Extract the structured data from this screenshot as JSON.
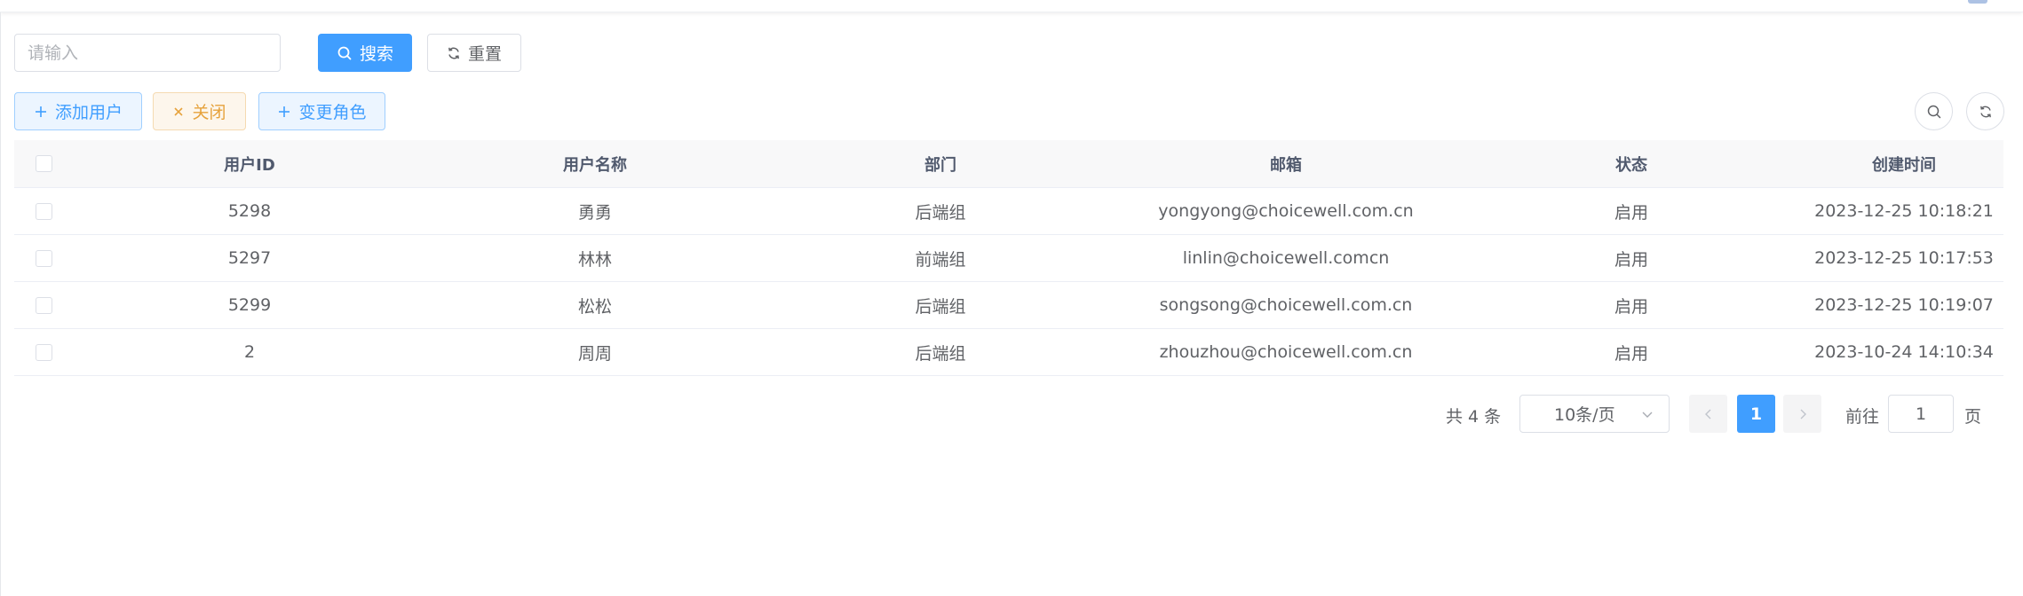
{
  "search": {
    "placeholder": "请输入",
    "search_label": "搜索",
    "reset_label": "重置"
  },
  "toolbar": {
    "add_user_label": "添加用户",
    "close_label": "关闭",
    "change_role_label": "变更角色"
  },
  "table": {
    "headers": [
      "用户ID",
      "用户名称",
      "部门",
      "邮箱",
      "状态",
      "创建时间"
    ],
    "rows": [
      {
        "id": "5298",
        "name": "勇勇",
        "dept": "后端组",
        "email": "yongyong@choicewell.com.cn",
        "status": "启用",
        "created": "2023-12-25 10:18:21"
      },
      {
        "id": "5297",
        "name": "林林",
        "dept": "前端组",
        "email": "linlin@choicewell.comcn",
        "status": "启用",
        "created": "2023-12-25 10:17:53"
      },
      {
        "id": "5299",
        "name": "松松",
        "dept": "后端组",
        "email": "songsong@choicewell.com.cn",
        "status": "启用",
        "created": "2023-12-25 10:19:07"
      },
      {
        "id": "2",
        "name": "周周",
        "dept": "后端组",
        "email": "zhouzhou@choicewell.com.cn",
        "status": "启用",
        "created": "2023-10-24 14:10:34"
      }
    ]
  },
  "pagination": {
    "total_text": "共 4 条",
    "page_size": "10条/页",
    "current_page": "1",
    "goto_label": "前往",
    "goto_value": "1",
    "goto_suffix": "页"
  },
  "colors": {
    "primary": "#409eff",
    "warning": "#e6a23c",
    "border": "#dcdfe6",
    "header_bg": "#f8f8f9"
  },
  "icons": {
    "search_button": "search-icon",
    "reset_button": "refresh-icon",
    "add_user": "plus-icon",
    "close": "close-icon",
    "change_role": "plus-icon",
    "toolbar_search": "search-icon",
    "toolbar_refresh": "refresh-icon",
    "page_size": "chevron-down-icon",
    "prev": "chevron-left-icon",
    "next": "chevron-right-icon"
  }
}
